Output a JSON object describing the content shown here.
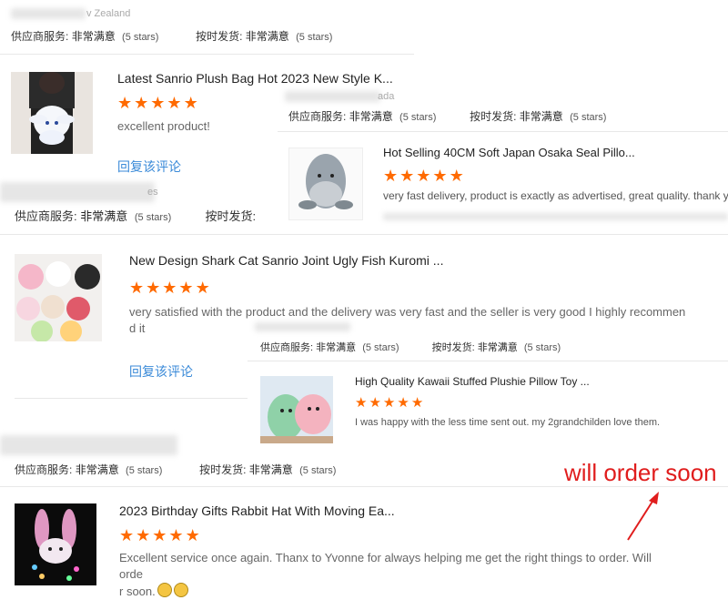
{
  "colors": {
    "star": "#ff6a00",
    "link": "#3a8ad8",
    "annotation": "#e01d1d"
  },
  "labels": {
    "supplier_service": "供应商服务:",
    "on_time_shipping": "按时发货:",
    "very_satisfied": "非常满意",
    "five_stars": "(5 stars)",
    "reply": "回复该评论"
  },
  "top": {
    "country": "v Zealand"
  },
  "reviews": [
    {
      "title": "Latest Sanrio Plush Bag Hot 2023 New Style K...",
      "stars": 5,
      "text": "excellent product!",
      "icon": "cinnamoroll-backpack-thumbnail"
    },
    {
      "title": "Hot Selling 40CM Soft Japan Osaka Seal Pillo...",
      "stars": 5,
      "text": "very fast delivery, product is exactly as advertised, great quality. thank you!",
      "country": "ada",
      "icon": "seal-plush-thumbnail"
    },
    {
      "title": "New Design Shark Cat Sanrio Joint Ugly Fish Kuromi ...",
      "stars": 5,
      "text_line1": "very satisfied with the product and the delivery was very fast and the seller is very good I highly recommen",
      "text_line2": "d it",
      "country": "es",
      "icon": "sanrio-plush-group-thumbnail"
    },
    {
      "title": "High Quality Kawaii Stuffed Plushie Pillow Toy ...",
      "stars": 5,
      "text": "I was happy with the less time sent out. my 2grandchilden love them.",
      "icon": "plushie-pillows-thumbnail"
    },
    {
      "title": "2023 Birthday Gifts Rabbit Hat With Moving Ea...",
      "stars": 5,
      "text_line1": "Excellent service once again. Thanx to Yvonne for always helping me get the right things to order.  Will orde",
      "text_line2": "r soon.",
      "icon": "rabbit-hat-thumbnail"
    }
  ],
  "annotation": {
    "text": "will order soon"
  }
}
